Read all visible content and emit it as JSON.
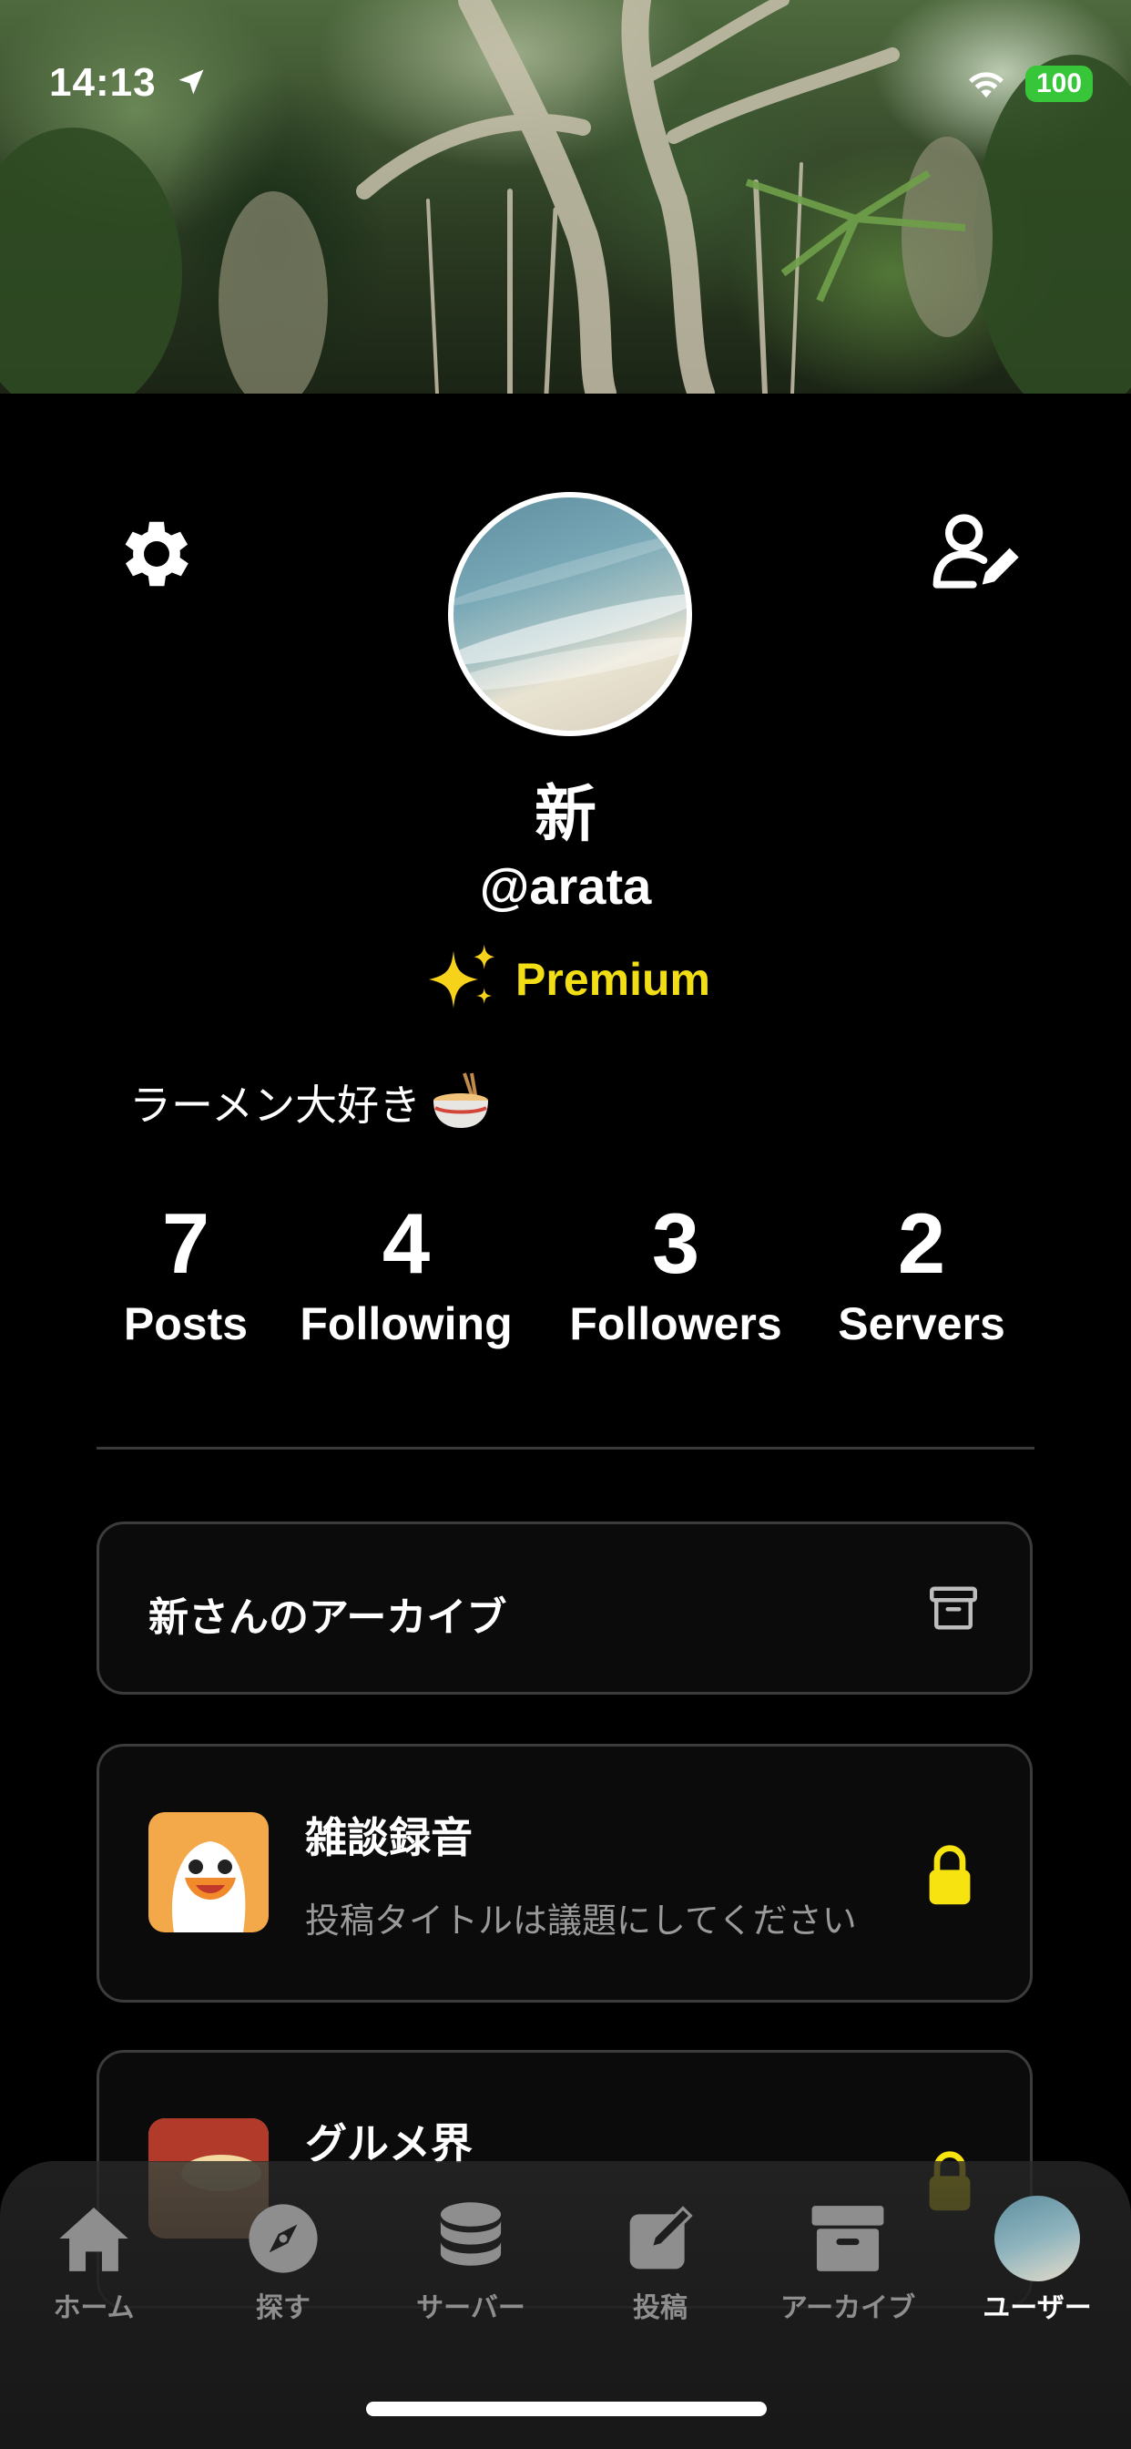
{
  "status_bar": {
    "time": "14:13",
    "battery": "100"
  },
  "profile": {
    "display_name": "新",
    "handle": "@arata",
    "premium_label": "Premium",
    "bio": "ラーメン大好き"
  },
  "stats": [
    {
      "value": "7",
      "label": "Posts"
    },
    {
      "value": "4",
      "label": "Following"
    },
    {
      "value": "3",
      "label": "Followers"
    },
    {
      "value": "2",
      "label": "Servers"
    }
  ],
  "archive_card": {
    "title": "新さんのアーカイブ",
    "icon": "archive-box-icon"
  },
  "servers": [
    {
      "name": "雑談録音",
      "description": "投稿タイトルは議題にしてください",
      "locked": true,
      "lock_color": "#f7e30f"
    },
    {
      "name": "グルメ界",
      "description": "",
      "locked": true,
      "lock_color": "#f7e30f"
    }
  ],
  "tabbar": {
    "tabs": [
      {
        "label": "ホーム",
        "icon": "home-icon"
      },
      {
        "label": "探す",
        "icon": "compass-icon"
      },
      {
        "label": "サーバー",
        "icon": "database-icon"
      },
      {
        "label": "投稿",
        "icon": "compose-icon"
      },
      {
        "label": "アーカイブ",
        "icon": "archive-icon"
      },
      {
        "label": "ユーザー",
        "icon": "user-avatar-icon",
        "active": true
      }
    ]
  },
  "colors": {
    "premium": "#f2de15",
    "background": "#000000",
    "card_border": "#3c3c3c"
  }
}
